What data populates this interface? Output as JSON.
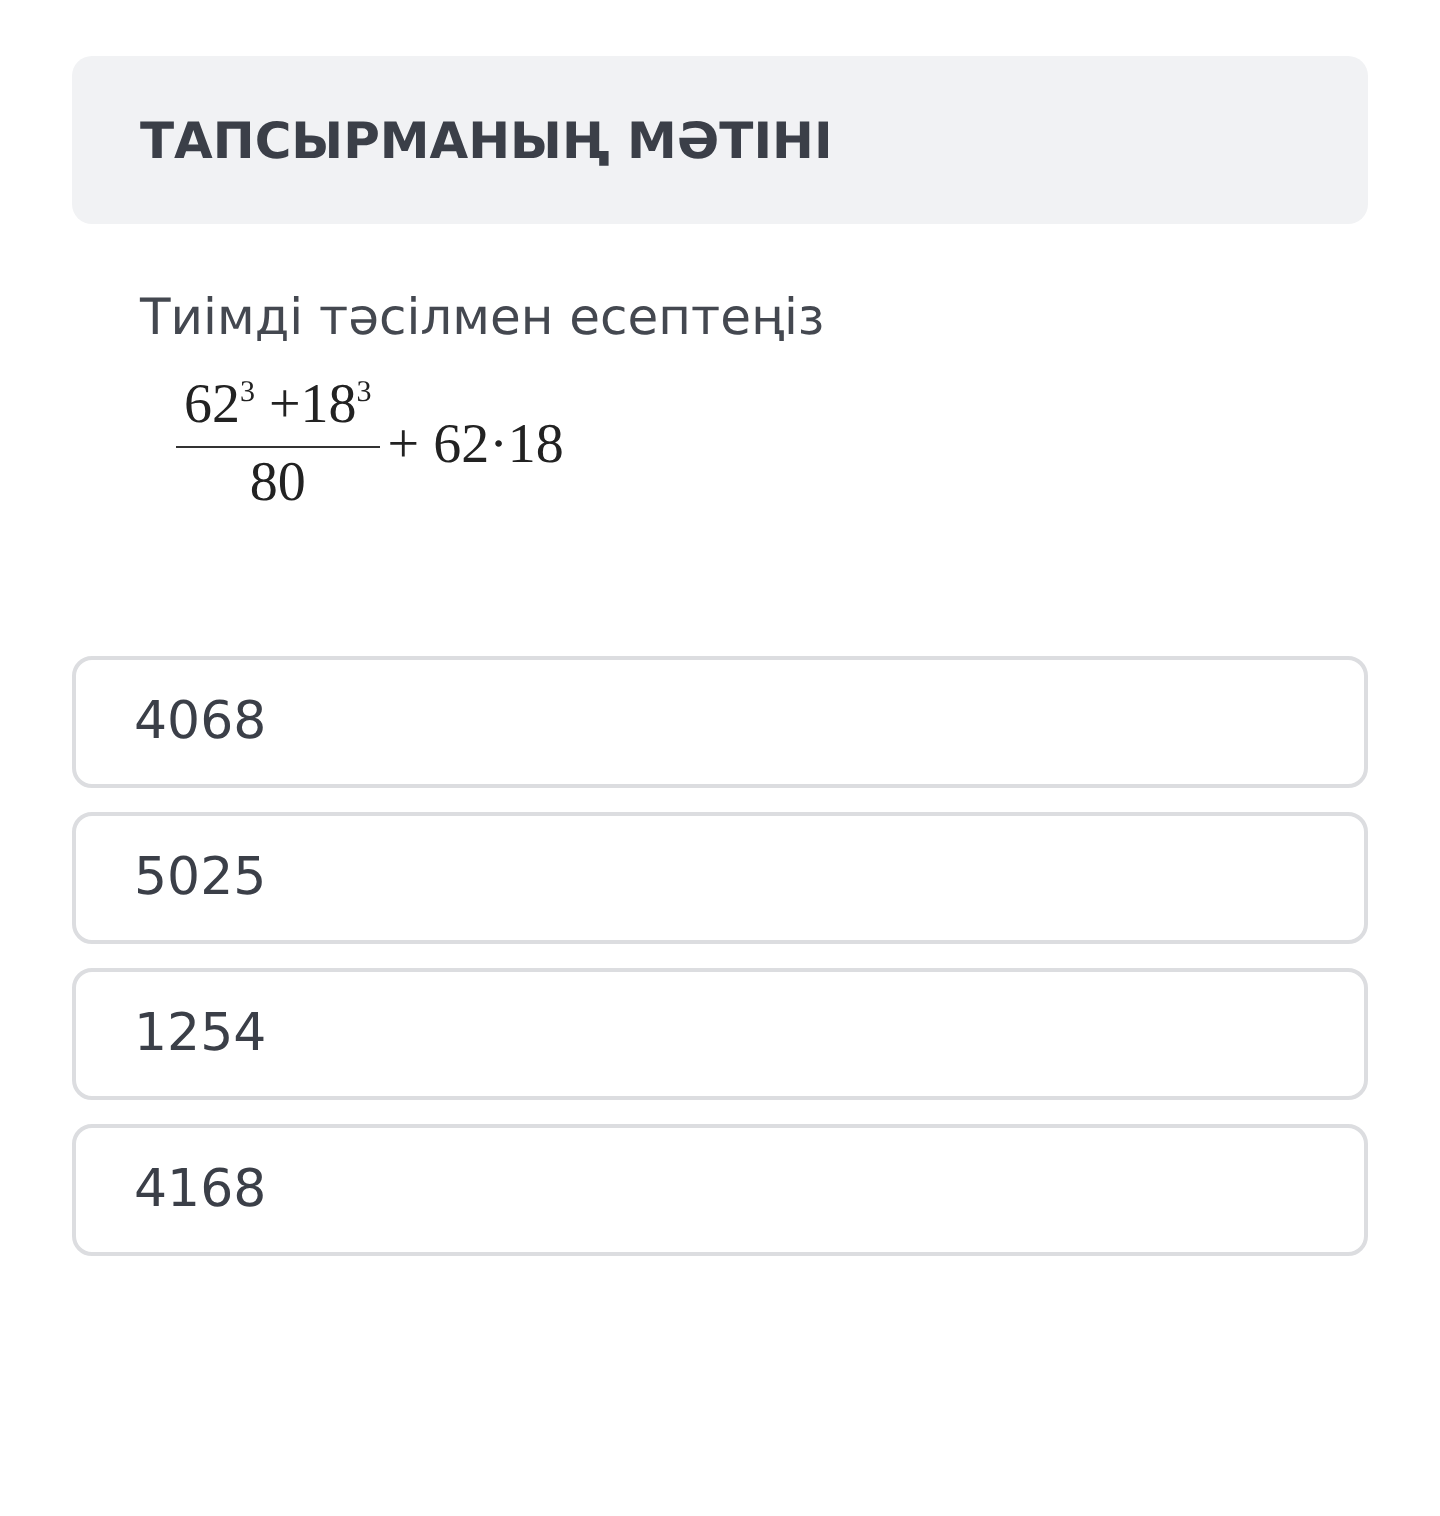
{
  "task": {
    "title": "ТАПСЫРМАНЫҢ МӘТІНІ",
    "question": "Тиімді тәсілмен есептеңіз",
    "formula": {
      "numerator": "62$^{3}$ +18$^{3}$",
      "denominator": "80",
      "rest": "+ 62·18"
    }
  },
  "answers": [
    {
      "label": "4068"
    },
    {
      "label": "5025"
    },
    {
      "label": "1254"
    },
    {
      "label": "4168"
    }
  ]
}
